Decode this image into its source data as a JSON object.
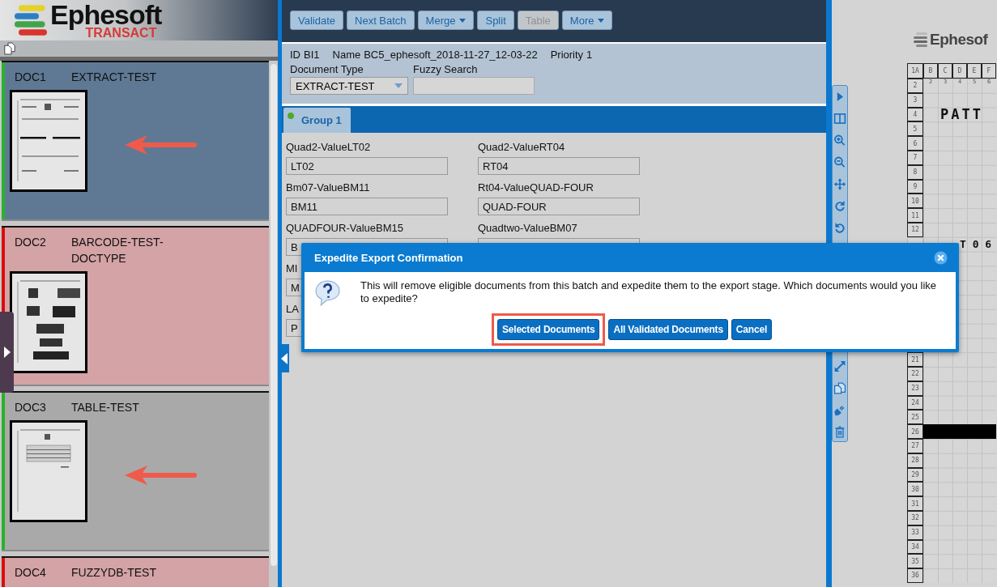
{
  "logo": {
    "name": "Ephesoft",
    "product": "TRANSACT"
  },
  "documents": [
    {
      "id": "DOC1",
      "type": "EXTRACT-TEST",
      "valid": true,
      "selected": true,
      "thumbnail": {
        "kind": "form"
      },
      "arrow": true
    },
    {
      "id": "DOC2",
      "type": "BARCODE-TEST-DOCTYPE",
      "valid": false,
      "selected": false,
      "thumbnail": {
        "kind": "barcode"
      },
      "arrow": false
    },
    {
      "id": "DOC3",
      "type": "TABLE-TEST",
      "valid": true,
      "selected": false,
      "thumbnail": {
        "kind": "table"
      },
      "arrow": true
    },
    {
      "id": "DOC4",
      "type": "FUZZYDB-TEST",
      "valid": false,
      "selected": false
    }
  ],
  "toolbar": [
    {
      "label": "Validate",
      "disabled": false,
      "dropdown": false
    },
    {
      "label": "Next Batch",
      "disabled": false,
      "dropdown": false
    },
    {
      "label": "Merge",
      "disabled": false,
      "dropdown": true
    },
    {
      "label": "Split",
      "disabled": false,
      "dropdown": false
    },
    {
      "label": "Table",
      "disabled": true,
      "dropdown": false
    },
    {
      "label": "More",
      "disabled": false,
      "dropdown": true
    }
  ],
  "batch": {
    "id_label": "ID",
    "id": "BI1",
    "name_label": "Name",
    "name": "BC5_ephesoft_2018-11-27_12-03-22",
    "priority_label": "Priority",
    "priority": "1"
  },
  "document_type": {
    "label": "Document Type",
    "value": "EXTRACT-TEST"
  },
  "fuzzy_search": {
    "label": "Fuzzy Search"
  },
  "tabs": [
    {
      "label": "Group 1",
      "selected": true,
      "color": "#4fa82a"
    }
  ],
  "field_rows": [
    [
      {
        "label": "Quad2-ValueLT02",
        "value": "LT02"
      },
      {
        "label": "Quad2-ValueRT04",
        "value": "RT04"
      }
    ],
    [
      {
        "label": "Bm07-ValueBM11",
        "value": "BM11"
      },
      {
        "label": "Rt04-ValueQUAD-FOUR",
        "value": "QUAD-FOUR"
      }
    ],
    [
      {
        "label": "QUADFOUR-ValueBM15",
        "value": "B"
      },
      {
        "label": "Quadtwo-ValueBM07"
      }
    ],
    [
      {
        "label": "MI",
        "value": "M"
      }
    ],
    [
      {
        "label": "LA",
        "value": "P"
      }
    ]
  ],
  "dialog": {
    "title": "Expedite Export Confirmation",
    "message": "This will remove eligible documents from this batch and expedite them to the export stage. Which documents would you like to expedite?",
    "buttons": [
      {
        "label": "Selected Documents",
        "highlighted": true
      },
      {
        "label": "All Validated Documents",
        "highlighted": false
      },
      {
        "label": "Cancel",
        "highlighted": false
      }
    ]
  },
  "viewer_tools_top": [
    {
      "kind": "play"
    },
    {
      "kind": "columns"
    },
    {
      "kind": "zoom-in"
    },
    {
      "kind": "zoom-out"
    },
    {
      "kind": "move"
    },
    {
      "kind": "redo"
    },
    {
      "kind": "undo"
    }
  ],
  "viewer_tools_bottom": [
    {
      "kind": "expand"
    },
    {
      "kind": "copy"
    },
    {
      "kind": "plug"
    },
    {
      "kind": "trash"
    }
  ],
  "viewer": {
    "logo": "Ephesof",
    "col_headers": [
      "1A",
      "B",
      "C",
      "D",
      "E",
      "F"
    ],
    "col_numbers": [
      "2",
      "3",
      "4",
      "5",
      "6"
    ],
    "rows": [
      {
        "label": "2"
      },
      {
        "label": "3"
      },
      {
        "label": "4",
        "text": "PATT"
      },
      {
        "label": "5"
      },
      {
        "label": "6"
      },
      {
        "label": "7"
      },
      {
        "label": "8"
      },
      {
        "label": "9"
      },
      {
        "label": "10"
      },
      {
        "label": "11"
      },
      {
        "label": "12"
      },
      {
        "text": "T 0 6"
      },
      {},
      {},
      {},
      {},
      {},
      {},
      {},
      {
        "label": "21"
      },
      {
        "label": "22"
      },
      {
        "label": "23"
      },
      {
        "label": "24"
      },
      {
        "label": "25"
      },
      {
        "label": "26",
        "filled": true
      },
      {
        "label": "27"
      },
      {
        "label": "28"
      },
      {
        "label": "29"
      },
      {
        "label": "30"
      },
      {
        "label": "31"
      },
      {
        "label": "32"
      },
      {
        "label": "33"
      },
      {
        "label": "34"
      },
      {
        "label": "35"
      },
      {
        "label": "36"
      }
    ]
  }
}
